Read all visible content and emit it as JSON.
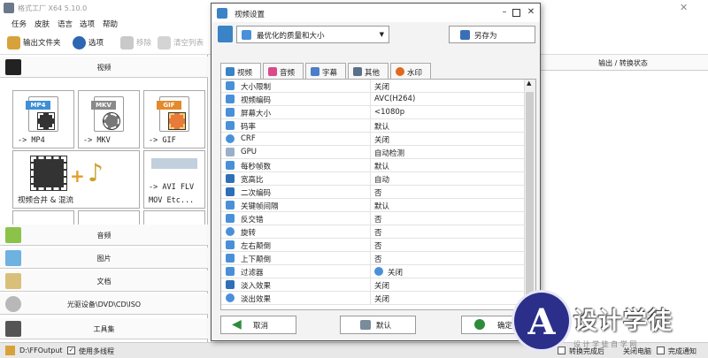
{
  "main": {
    "title": "格式工厂 X64 5.10.0",
    "menu": [
      "任务",
      "皮肤",
      "语言",
      "选项",
      "帮助"
    ],
    "toolbar": {
      "output_folder": "输出文件夹",
      "options": "选项",
      "remove": "移除",
      "clear_list": "清空列表"
    },
    "categories": {
      "video": "视频",
      "audio": "音频",
      "image": "图片",
      "document": "文档",
      "disc": "光驱设备\\DVD\\CD\\ISO",
      "toolbox": "工具集"
    },
    "tiles": [
      {
        "badge": "MP4",
        "label": "-> MP4",
        "color": "#3f8fd6"
      },
      {
        "badge": "MKV",
        "label": "-> MKV",
        "color": "#8a8a8a"
      },
      {
        "badge": "GIF",
        "label": "-> GIF",
        "color": "#e38a2a"
      },
      {
        "label": "视频合并 & 混流"
      },
      {
        "label_line1": "-> AVI FLV",
        "label_line2": "MOV Etc..."
      }
    ],
    "output_status_header": "输出 / 转换状态",
    "statusbar": {
      "output_path": "D:\\FFOutput",
      "multithread": "使用多线程",
      "after_done": "转换完成后",
      "shutdown": "关闭电脑",
      "notify": "完成通知"
    }
  },
  "dialog": {
    "title": "视频设置",
    "preset": "最优化的质量和大小",
    "save_as": "另存为",
    "tabs": [
      "视频",
      "音频",
      "字幕",
      "其他",
      "水印"
    ],
    "rows": [
      {
        "name": "大小限制",
        "value": "关闭",
        "icon": "#4a90d9"
      },
      {
        "name": "视频编码",
        "value": "AVC(H264)",
        "icon": "#4a90d9"
      },
      {
        "name": "屏幕大小",
        "value": "<1080p",
        "icon": "#4a90d9"
      },
      {
        "name": "码率",
        "value": "默认",
        "icon": "#4a90d9"
      },
      {
        "name": "CRF",
        "value": "关闭",
        "icon": "#4a90d9"
      },
      {
        "name": "GPU",
        "value": "自动检测",
        "icon": "#9ab0c8"
      },
      {
        "name": "每秒帧数",
        "value": "默认",
        "icon": "#4a90d9"
      },
      {
        "name": "宽高比",
        "value": "自动",
        "icon": "#2f6fb8"
      },
      {
        "name": "二次编码",
        "value": "否",
        "icon": "#2f6fb8"
      },
      {
        "name": "关键帧间隔",
        "value": "默认",
        "icon": "#4a90d9"
      },
      {
        "name": "反交错",
        "value": "否",
        "icon": "#4a90d9"
      },
      {
        "name": "旋转",
        "value": "否",
        "icon": "#4a90d9"
      },
      {
        "name": "左右颠倒",
        "value": "否",
        "icon": "#4a90d9"
      },
      {
        "name": "上下颠倒",
        "value": "否",
        "icon": "#4a90d9"
      },
      {
        "name": "过滤器",
        "value": "关闭",
        "icon": "#4a90d9"
      },
      {
        "name": "淡入效果",
        "value": "关闭",
        "icon": "#2f6fb8"
      },
      {
        "name": "淡出效果",
        "value": "关闭",
        "icon": "#4a90d9"
      }
    ],
    "cancel": "取消",
    "default": "默认",
    "ok": "确定"
  },
  "watermark": {
    "mark": "A",
    "text": "设计学徒",
    "sub": "设 计 学 徒 自 学 网"
  }
}
